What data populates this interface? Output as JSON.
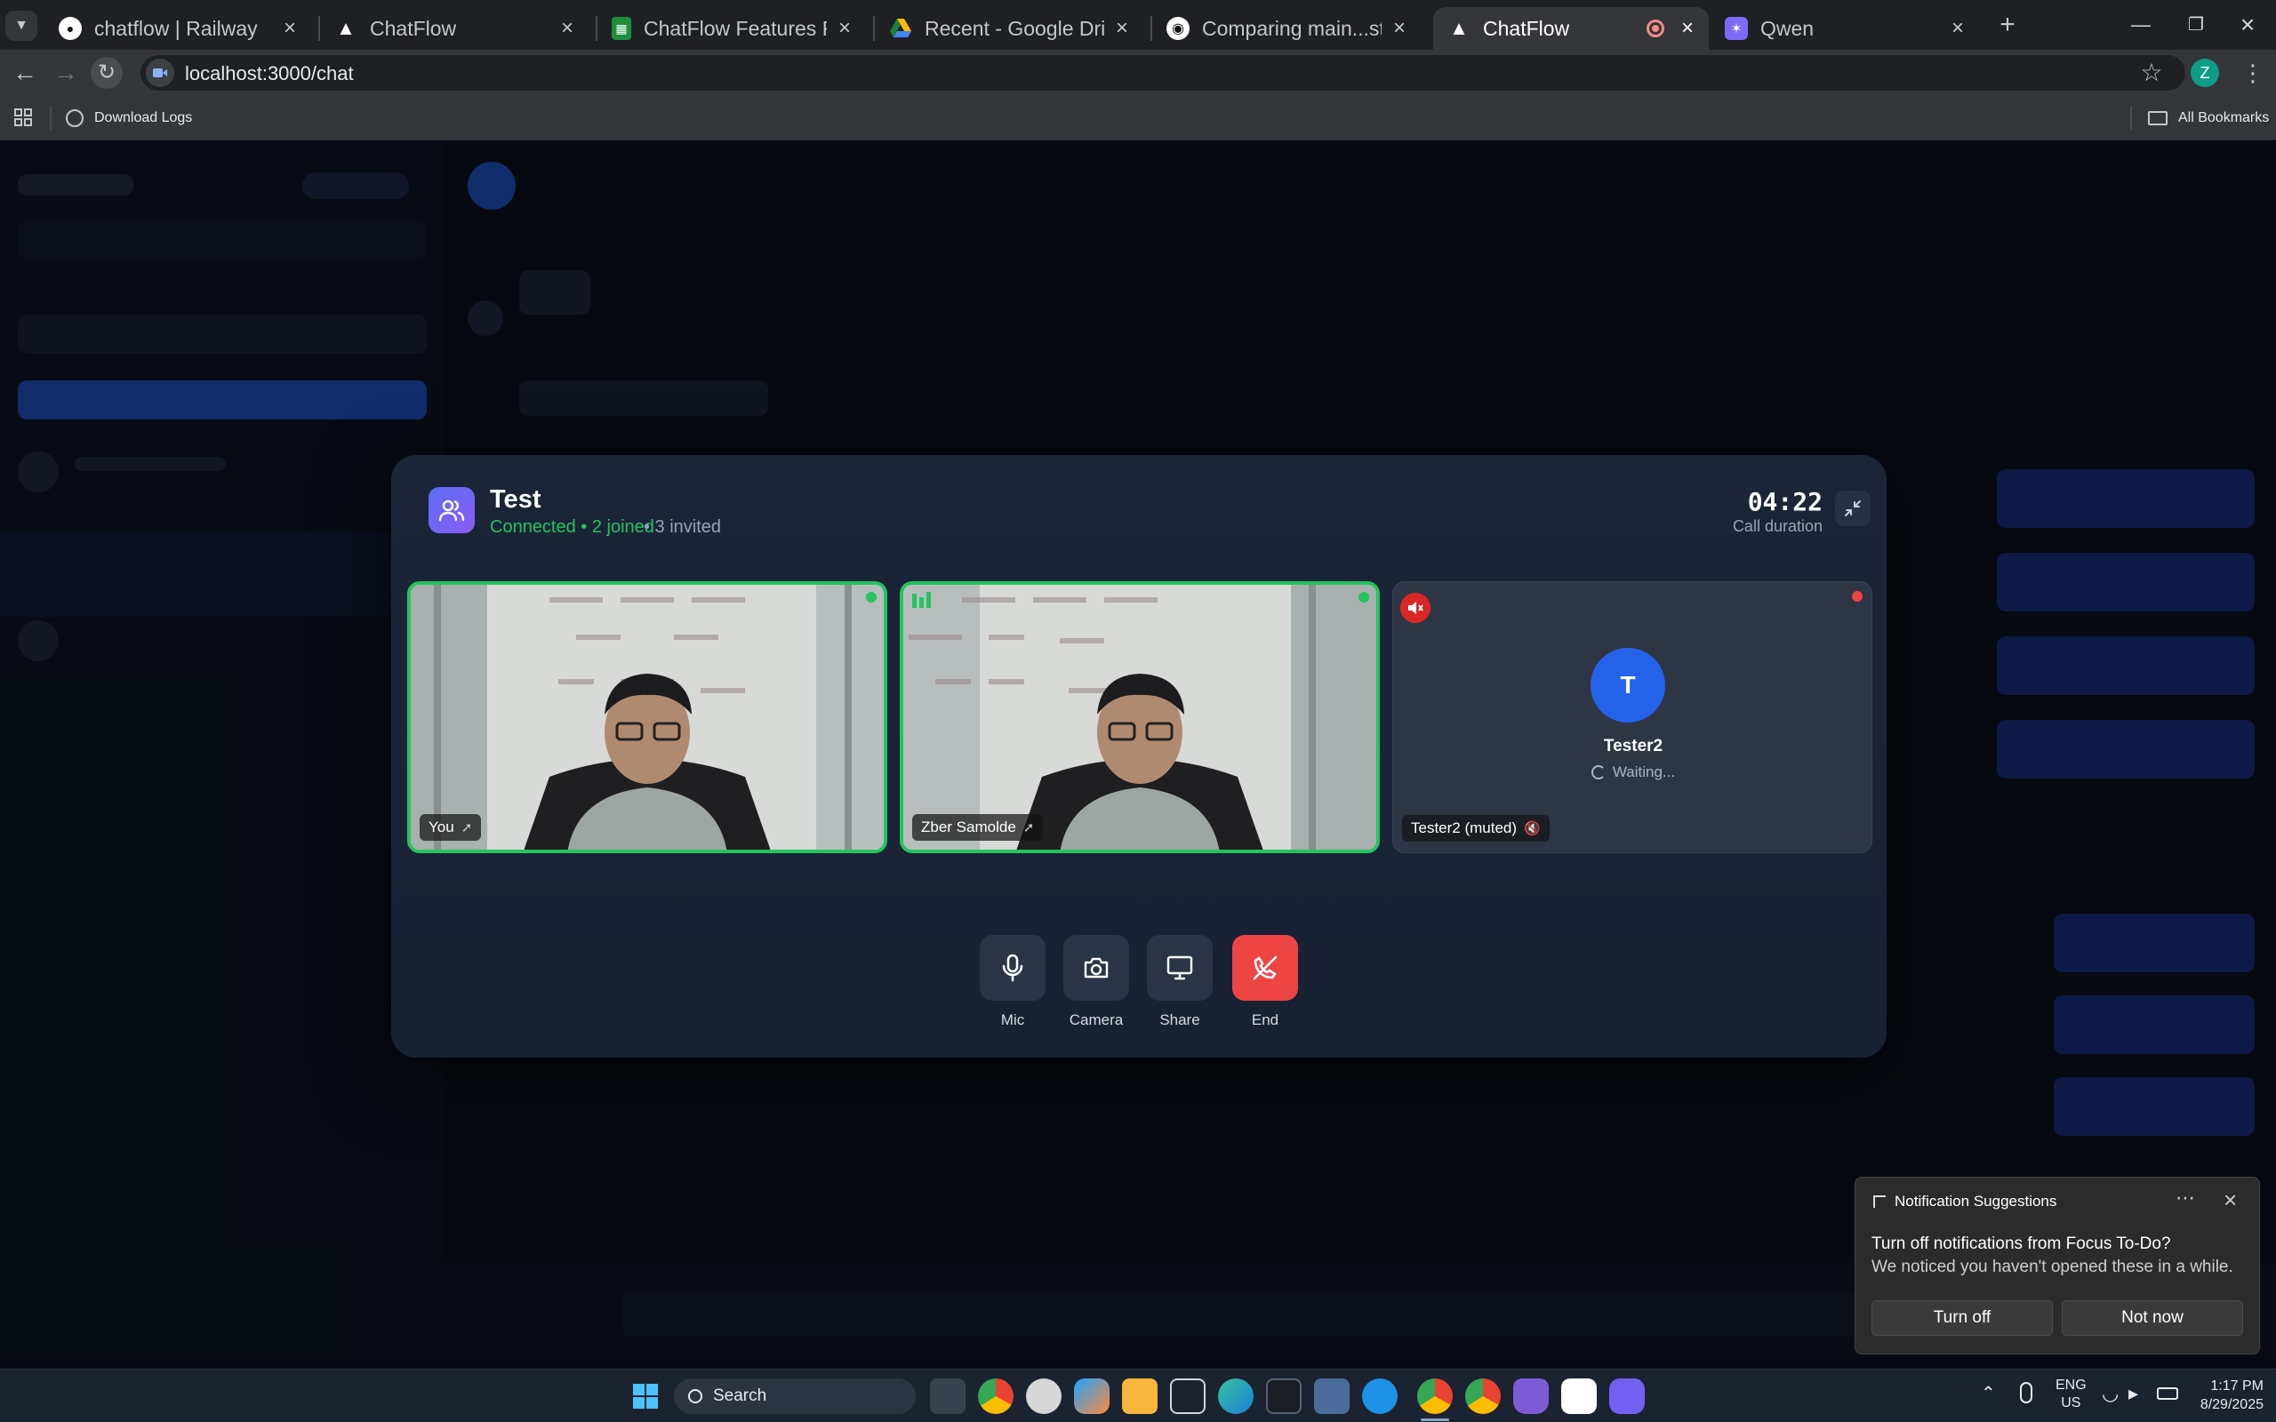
{
  "browser": {
    "tabs": [
      {
        "title": "chatflow | Railway",
        "active": false,
        "icon": "railway-icon"
      },
      {
        "title": "ChatFlow",
        "active": false,
        "icon": "chatflow-icon"
      },
      {
        "title": "ChatFlow Features Report - Google",
        "active": false,
        "icon": "google-sheets-icon"
      },
      {
        "title": "Recent - Google Drive",
        "active": false,
        "icon": "google-drive-icon"
      },
      {
        "title": "Comparing main...staging · aio-zbe",
        "active": false,
        "icon": "github-icon"
      },
      {
        "title": "ChatFlow",
        "active": true,
        "icon": "chatflow-icon"
      },
      {
        "title": "Qwen",
        "active": false,
        "icon": "qwen-icon"
      }
    ],
    "url": "localhost:3000/chat",
    "bookmarks": [
      {
        "label": "Download Logs"
      }
    ],
    "all_bookmarks": "All Bookmarks",
    "profile_initial": "Z"
  },
  "call": {
    "title": "Test",
    "status": "Connected • 2 joined",
    "invited": "• 3 invited",
    "duration": "04:22",
    "duration_label": "Call duration",
    "participants": [
      {
        "name": "You",
        "type": "video",
        "speaking": true
      },
      {
        "name": "Zber Samolde",
        "type": "video",
        "speaking": true
      },
      {
        "name": "Tester2 (muted)",
        "display_name": "Tester2",
        "initial": "T",
        "status": "Waiting...",
        "type": "avatar",
        "muted": true
      }
    ],
    "controls": [
      {
        "label": "Mic",
        "icon": "mic-icon"
      },
      {
        "label": "Camera",
        "icon": "camera-icon"
      },
      {
        "label": "Share",
        "icon": "monitor-icon"
      },
      {
        "label": "End",
        "icon": "end-call-icon"
      }
    ]
  },
  "notification": {
    "header": "Notification Suggestions",
    "title": "Turn off notifications from Focus To-Do?",
    "body": "We noticed you haven't opened these in a while.",
    "primary": "Turn off",
    "secondary": "Not now"
  },
  "taskbar": {
    "search_placeholder": "Search",
    "lang_top": "ENG",
    "lang_bottom": "US",
    "time": "1:17 PM",
    "date": "8/29/2025"
  },
  "colors": {
    "accent_green": "#22c55e",
    "end_red": "#ef4444",
    "avatar_blue": "#2563eb"
  }
}
